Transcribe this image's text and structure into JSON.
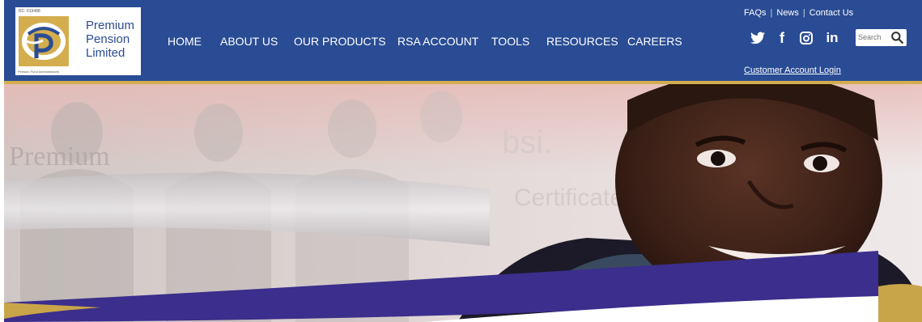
{
  "logo": {
    "rc_number": "RC: 619488",
    "name_lines": [
      "Premium",
      "Pension",
      "Limited"
    ],
    "tagline": "Pension Fund Administrators",
    "brand_gold": "#d4ae4e",
    "brand_blue": "#2a4c94"
  },
  "nav": {
    "items": [
      {
        "label": "HOME"
      },
      {
        "label": "ABOUT US"
      },
      {
        "label": "OUR PRODUCTS"
      },
      {
        "label": "RSA ACCOUNT"
      },
      {
        "label": "TOOLS"
      },
      {
        "label": "RESOURCES"
      },
      {
        "label": "CAREERS"
      }
    ]
  },
  "utility_links": {
    "faqs": "FAQs",
    "news": "News",
    "contact": "Contact Us",
    "separator": "|"
  },
  "social": {
    "twitter": "twitter-icon",
    "facebook": "facebook-icon",
    "instagram": "instagram-icon",
    "linkedin": "linkedin-icon",
    "linkedin_text": "in",
    "facebook_text": "f"
  },
  "search": {
    "placeholder": "Search"
  },
  "account": {
    "login_label": "Customer Account Login"
  },
  "hero": {
    "background_text_1": "Premium",
    "background_text_2": "bsi.",
    "background_text_3": "Certificate of R",
    "accent_purple": "#3b2e8c"
  },
  "colors": {
    "header_bg": "#2a4c94",
    "gold_line": "#d4ae4e"
  }
}
